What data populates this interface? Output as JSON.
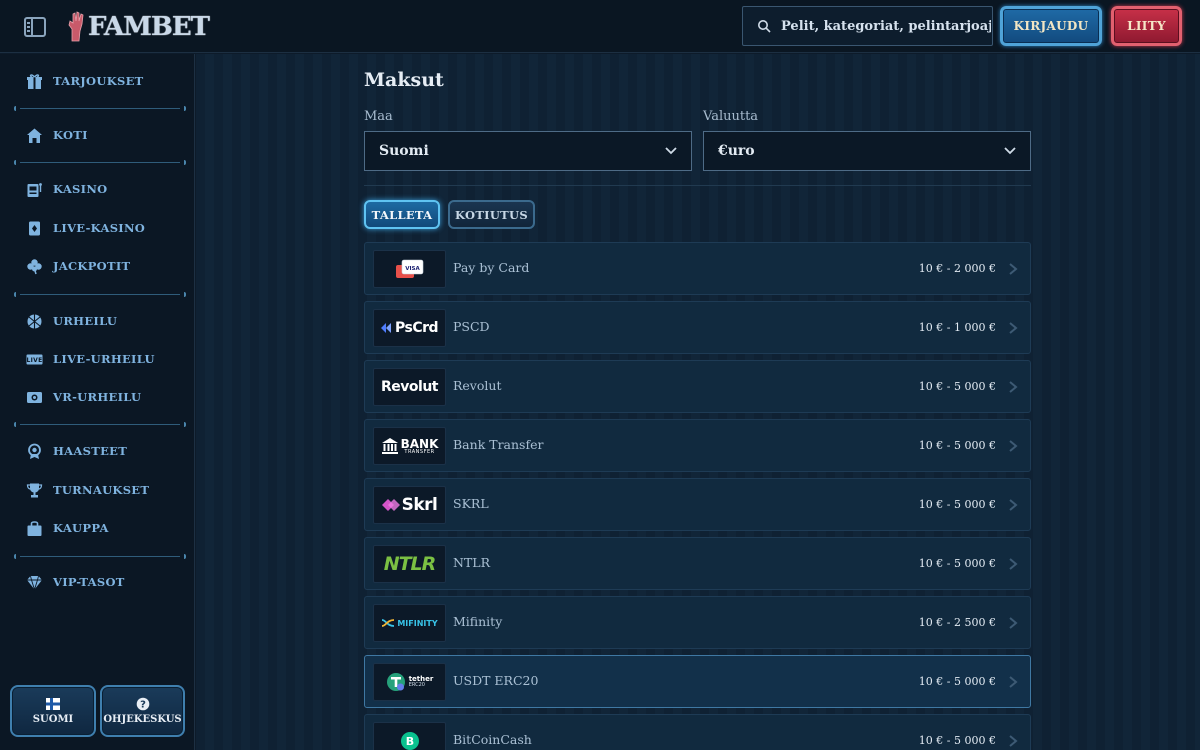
{
  "header": {
    "brand": "FAMBET",
    "search_placeholder": "Pelit, kategoriat, pelintarjoajat",
    "login_label": "KIRJAUDU",
    "join_label": "LIITY"
  },
  "sidebar": {
    "items": [
      {
        "label": "TARJOUKSET",
        "icon": "gift-icon"
      },
      {
        "label": "KOTI",
        "icon": "home-icon"
      },
      {
        "label": "KASINO",
        "icon": "slot-machine-icon"
      },
      {
        "label": "LIVE-KASINO",
        "icon": "card-icon"
      },
      {
        "label": "JACKPOTIT",
        "icon": "clover-icon"
      },
      {
        "label": "URHEILU",
        "icon": "ball-icon"
      },
      {
        "label": "LIVE-URHEILU",
        "icon": "live-icon"
      },
      {
        "label": "VR-URHEILU",
        "icon": "vr-icon"
      },
      {
        "label": "HAASTEET",
        "icon": "badge-icon"
      },
      {
        "label": "TURNAUKSET",
        "icon": "trophy-icon"
      },
      {
        "label": "KAUPPA",
        "icon": "shop-bag-icon"
      },
      {
        "label": "VIP-TASOT",
        "icon": "diamond-icon"
      }
    ],
    "footer": {
      "language_label": "SUOMI",
      "help_label": "OHJEKESKUS"
    }
  },
  "main": {
    "title": "Maksut",
    "country_label": "Maa",
    "country_value": "Suomi",
    "currency_label": "Valuutta",
    "currency_value": "€uro",
    "tabs": {
      "deposit": "TALLETA",
      "withdraw": "KOTIUTUS"
    },
    "methods": [
      {
        "name": "Pay by Card",
        "limit": "10 € - 2 000 €",
        "logo": "VISA"
      },
      {
        "name": "PSCD",
        "limit": "10 € - 1 000 €",
        "logo": "PsCrd"
      },
      {
        "name": "Revolut",
        "limit": "10 € - 5 000 €",
        "logo": "Revolut"
      },
      {
        "name": "Bank Transfer",
        "limit": "10 € - 5 000 €",
        "logo": "BANK",
        "logo_sub": "TRANSFER"
      },
      {
        "name": "SKRL",
        "limit": "10 € - 5 000 €",
        "logo": "Skrl"
      },
      {
        "name": "NTLR",
        "limit": "10 € - 5 000 €",
        "logo": "NTLR"
      },
      {
        "name": "Mifinity",
        "limit": "10 € - 2 500 €",
        "logo": "MIFINITY"
      },
      {
        "name": "USDT ERC20",
        "limit": "10 € - 5 000 €",
        "logo": "tether",
        "logo_sub": "ERC20"
      },
      {
        "name": "BitCoinCash",
        "limit": "10 € - 5 000 €",
        "logo": "B"
      }
    ]
  },
  "colors": {
    "accent_blue": "#1f6aa6",
    "accent_red": "#c73048",
    "nav_text": "#7fb3df",
    "ntlr_green": "#7bc043",
    "skrl_pink": "#d455c9",
    "pscd_blue": "#4f7dff"
  }
}
